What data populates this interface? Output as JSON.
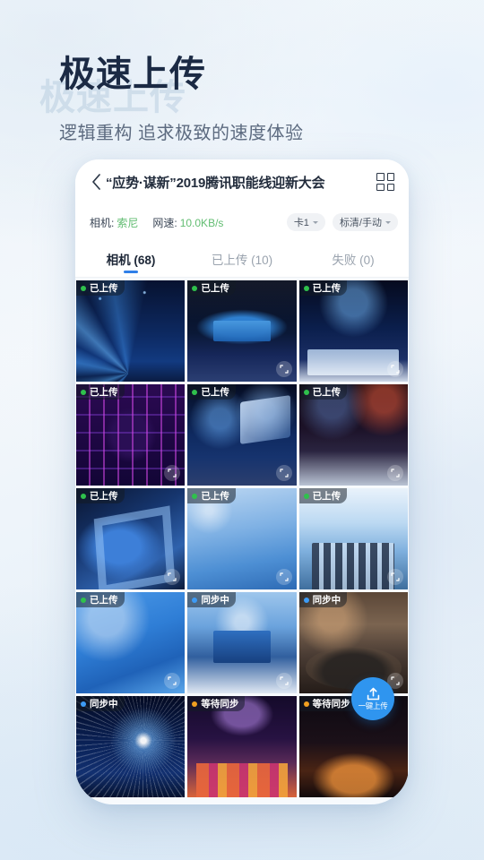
{
  "hero": {
    "title": "极速上传",
    "subtitle": "逻辑重构 追求极致的速度体验"
  },
  "card": {
    "header": {
      "back_icon": "chevron-left-icon",
      "title": "“应势·谋新”2019腾讯职能线迎新大会",
      "grid_icon": "grid-view-icon"
    },
    "info": {
      "camera_label": "相机:",
      "camera_value": "索尼",
      "speed_label": "网速:",
      "speed_value": "10.0KB/s",
      "card_select": "卡1",
      "quality_select": "标清/手动"
    },
    "tabs": [
      {
        "label": "相机 (68)",
        "active": true
      },
      {
        "label": "已上传 (10)",
        "active": false
      },
      {
        "label": "失败 (0)",
        "active": false
      }
    ],
    "fab": {
      "label": "一键上传",
      "icon": "upload-icon",
      "color": "#2f95ef"
    },
    "status_colors": {
      "uploaded": "#2fc14c",
      "syncing": "#3d9bf5",
      "waiting": "#f0a020"
    },
    "thumbnails": [
      {
        "status": "已上传",
        "dot": "green",
        "art": "a-stage-blue",
        "expand": false
      },
      {
        "status": "已上传",
        "dot": "green",
        "art": "a-stage-screen",
        "expand": true
      },
      {
        "status": "已上传",
        "dot": "green",
        "art": "a-panel",
        "expand": true
      },
      {
        "status": "已上传",
        "dot": "green",
        "art": "a-tunnel",
        "expand": true
      },
      {
        "status": "已上传",
        "dot": "green",
        "art": "a-crowd-blue",
        "expand": true
      },
      {
        "status": "已上传",
        "dot": "green",
        "art": "a-dark-stage",
        "expand": true
      },
      {
        "status": "已上传",
        "dot": "green",
        "art": "a-blue-3d",
        "expand": true
      },
      {
        "status": "已上传",
        "dot": "green",
        "art": "a-innov",
        "expand": true
      },
      {
        "status": "已上传",
        "dot": "green",
        "art": "a-group",
        "expand": true
      },
      {
        "status": "已上传",
        "dot": "green",
        "art": "a-newyear",
        "expand": true
      },
      {
        "status": "同步中",
        "dot": "blue",
        "art": "a-room",
        "expand": true
      },
      {
        "status": "同步中",
        "dot": "blue",
        "art": "a-banquet",
        "expand": true
      },
      {
        "status": "同步中",
        "dot": "blue",
        "art": "a-particles",
        "expand": false
      },
      {
        "status": "等待同步",
        "dot": "orange",
        "art": "a-concert",
        "expand": false
      },
      {
        "status": "等待同步",
        "dot": "orange",
        "art": "a-fire",
        "expand": false
      }
    ]
  }
}
